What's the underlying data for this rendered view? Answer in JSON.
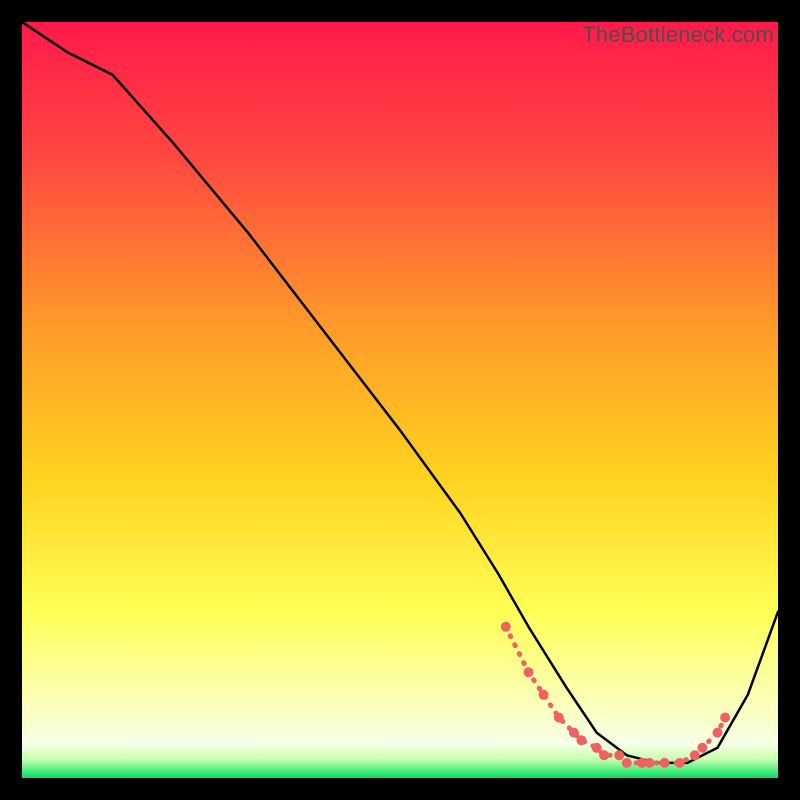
{
  "watermark": "TheBottleneck.com",
  "colors": {
    "gradient_top": "#ff1a4b",
    "gradient_mid_upper": "#ff7a2b",
    "gradient_mid": "#ffd21f",
    "gradient_mid_lower": "#ffff55",
    "gradient_low": "#fdffd0",
    "gradient_bottom": "#00e060",
    "curve": "#000000",
    "marker": "#ef6262",
    "frame_bg": "#000000"
  },
  "chart_data": {
    "type": "line",
    "title": "",
    "xlabel": "",
    "ylabel": "",
    "xlim": [
      0,
      100
    ],
    "ylim": [
      0,
      100
    ],
    "series": [
      {
        "name": "bottleneck-curve",
        "x": [
          0,
          6,
          12,
          20,
          30,
          40,
          50,
          58,
          63,
          67,
          72,
          76,
          80,
          84,
          88,
          92,
          96,
          100
        ],
        "y": [
          100,
          96,
          93,
          84,
          72,
          59,
          46,
          35,
          27,
          20,
          12,
          6,
          3,
          2,
          2,
          4,
          11,
          22
        ]
      }
    ],
    "markers": {
      "name": "highlighted-points",
      "x": [
        64,
        67,
        69,
        71,
        73,
        74,
        76,
        77,
        79,
        80,
        82,
        83,
        85,
        87,
        89,
        90,
        92,
        93
      ],
      "y": [
        20,
        14,
        11,
        8,
        6,
        5,
        4,
        3,
        3,
        2,
        2,
        2,
        2,
        2,
        3,
        4,
        6,
        8
      ]
    }
  }
}
